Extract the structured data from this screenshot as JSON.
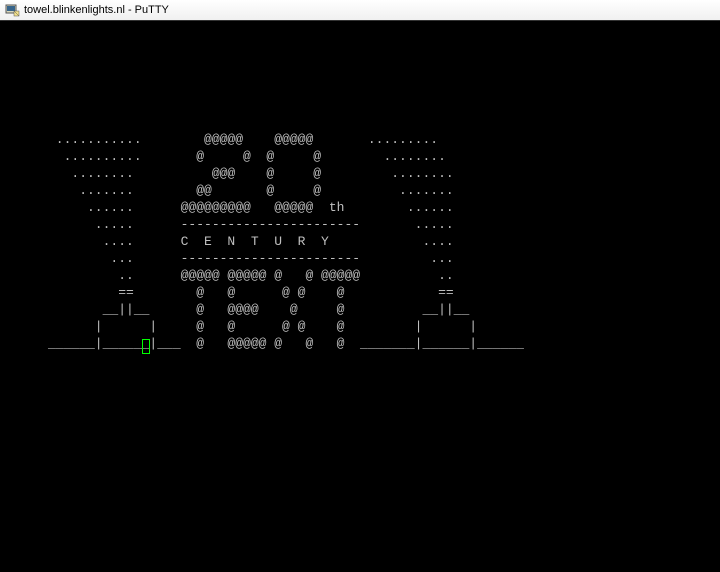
{
  "window": {
    "title": "towel.blinkenlights.nl - PuTTY",
    "icon_name": "putty-icon"
  },
  "ascii": {
    "lines": [
      " ...........        @@@@@    @@@@@       .........",
      "  ..........       @     @  @     @        ........",
      "   ........          @@@    @     @         ........",
      "    .......        @@       @     @          .......",
      "     ......      @@@@@@@@@   @@@@@  th        ......",
      "      .....      -----------------------       .....",
      "       ....      C  E  N  T  U  R  Y            ....",
      "        ...      -----------------------         ...",
      "         ..      @@@@@ @@@@@ @   @ @@@@@          ..",
      "         ==        @   @      @ @    @            ==",
      "       __||__      @   @@@@    @     @          __||__",
      "      |      |     @   @      @ @    @         |      |",
      "______|______|___  @   @@@@@ @   @   @  _______|______|______"
    ]
  }
}
